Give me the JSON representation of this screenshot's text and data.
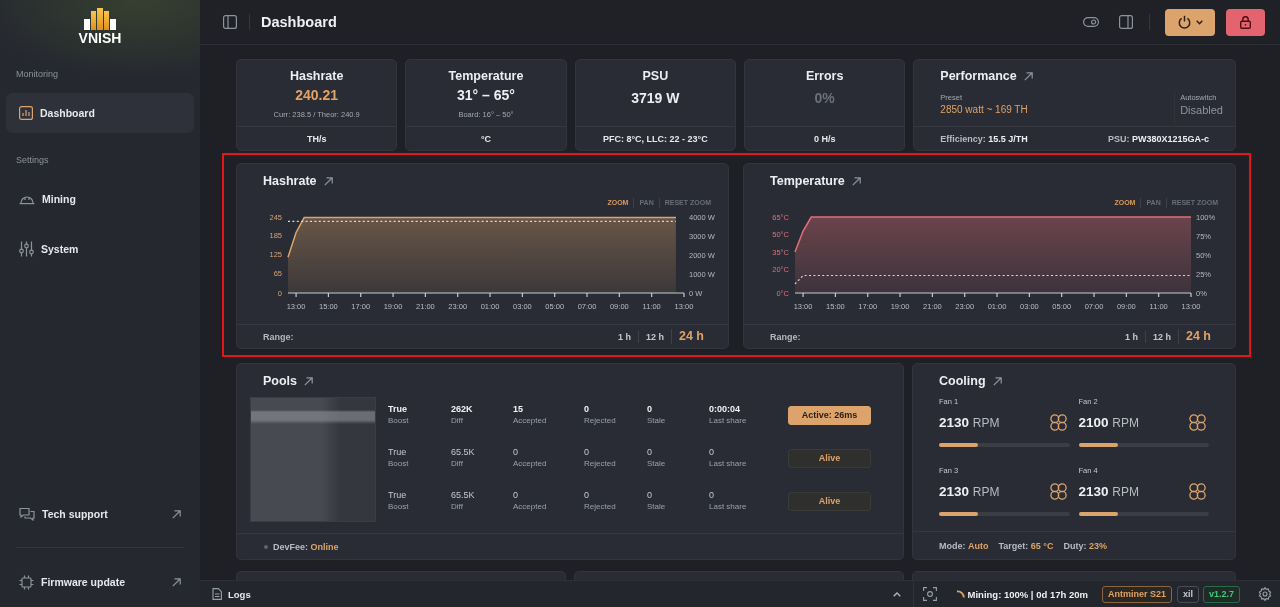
{
  "sidebar": {
    "logo": "VNISH",
    "sections": [
      {
        "heading": "Monitoring",
        "items": [
          {
            "label": "Dashboard",
            "selected": true
          }
        ]
      },
      {
        "heading": "Settings",
        "items": [
          {
            "label": "Mining",
            "selected": false
          },
          {
            "label": "System",
            "selected": false
          }
        ]
      }
    ],
    "links": [
      {
        "label": "Tech support",
        "external": true
      },
      {
        "label": "Firmware update",
        "external": true
      }
    ]
  },
  "header": {
    "title": "Dashboard"
  },
  "stats": [
    {
      "kind": "stat",
      "title": "Hashrate",
      "value": "240.21",
      "color": "#e0a265",
      "sub": "Curr: 238.5 / Theor: 240.9",
      "footer": "TH/s"
    },
    {
      "kind": "stat",
      "title": "Temperature",
      "value": "31° – 65°",
      "color": "#eceef1",
      "sub": "Board: 16° – 50°",
      "footer": "°C"
    },
    {
      "kind": "stat",
      "title": "PSU",
      "value": "3719 W",
      "color": "#eceef1",
      "footer": "PFC: 8°C, LLC: 22 - 23°C"
    },
    {
      "kind": "stat",
      "title": "Errors",
      "value": "0%",
      "color": "#6b7079",
      "footer": "0 H/s"
    },
    {
      "kind": "performance",
      "title": "Performance",
      "preset_label": "Preset",
      "preset": "2850 watt ~ 169 TH",
      "autoswitch_label": "Autoswitch",
      "autoswitch": "Disabled",
      "footer": [
        {
          "label": "Efficiency:",
          "value": "15.5 J/TH"
        },
        {
          "label": "PSU:",
          "value": "PW380X1215GA-c"
        }
      ]
    }
  ],
  "charts": {
    "highlighted": true,
    "items": [
      {
        "title": "Hashrate",
        "tools": [
          {
            "label": "ZOOM",
            "selected": true
          },
          {
            "label": "PAN",
            "selected": false
          },
          {
            "label": "RESET ZOOM",
            "selected": false
          }
        ],
        "chart_data": {
          "type": "area",
          "categories": [
            null,
            "13:00",
            null,
            null,
            null,
            "15:00",
            null,
            null,
            null,
            "17:00",
            null,
            null,
            null,
            "19:00",
            null,
            null,
            null,
            "21:00",
            null,
            null,
            null,
            "23:00",
            null,
            null,
            null,
            "01:00",
            null,
            null,
            null,
            "03:00",
            null,
            null,
            null,
            "05:00",
            null,
            null,
            null,
            "07:00",
            null,
            null,
            null,
            "09:00",
            null,
            null,
            null,
            "11:00",
            null,
            null,
            null,
            "13:00"
          ],
          "series": [
            {
              "color": "#dca46c",
              "values": [
                115,
                195,
                243,
                243,
                243,
                243,
                243,
                243,
                243,
                243,
                243,
                243,
                243,
                243,
                243,
                243,
                243,
                243,
                243,
                243,
                243,
                243,
                243,
                243,
                243,
                243,
                243,
                243,
                243,
                243,
                243,
                243,
                243,
                243,
                243,
                243,
                243,
                243,
                243,
                243,
                243,
                243,
                243,
                243,
                243,
                243,
                243,
                243,
                243,
                null
              ]
            },
            {
              "type": "line",
              "line_style": "dashed",
              "axis": "y2",
              "color": "#d9dadc",
              "values": [
                3770,
                3770,
                3770,
                3770,
                3770,
                3770,
                3770,
                3770,
                3770,
                3770,
                3770,
                3770,
                3770,
                3770,
                3770,
                3770,
                3770,
                3770,
                3770,
                3770,
                3770,
                3770,
                3770,
                3770,
                3770,
                3770,
                3770,
                3770,
                3770,
                3770,
                3770,
                3770,
                3770,
                3770,
                3770,
                3770,
                3770,
                3770,
                3770,
                3770,
                3770,
                3770,
                3770,
                3770,
                3770,
                3770,
                3770,
                3770,
                3770,
                null
              ]
            }
          ],
          "ylim": [
            0,
            245
          ],
          "yticks": [
            0,
            65,
            125,
            185,
            245
          ],
          "y2lim": [
            0,
            4000
          ],
          "y2ticks": [
            {
              "value": 0,
              "label": "0 W"
            },
            {
              "value": 1000,
              "label": "1000 W"
            },
            {
              "value": 2000,
              "label": "2000 W"
            },
            {
              "value": 3000,
              "label": "3000 W"
            },
            {
              "value": 4000,
              "label": "4000 W"
            }
          ]
        },
        "range_label": "Range:",
        "ranges": [
          {
            "label": "1 h",
            "selected": false
          },
          {
            "label": "12 h",
            "selected": false
          },
          {
            "label": "24 h",
            "selected": true
          }
        ]
      },
      {
        "title": "Temperature",
        "tools": [
          {
            "label": "ZOOM",
            "selected": true
          },
          {
            "label": "PAN",
            "selected": false
          },
          {
            "label": "RESET ZOOM",
            "selected": false
          }
        ],
        "chart_data": {
          "type": "area",
          "categories": [
            null,
            "13:00",
            null,
            null,
            null,
            "15:00",
            null,
            null,
            null,
            "17:00",
            null,
            null,
            null,
            "19:00",
            null,
            null,
            null,
            "21:00",
            null,
            null,
            null,
            "23:00",
            null,
            null,
            null,
            "01:00",
            null,
            null,
            null,
            "03:00",
            null,
            null,
            null,
            "05:00",
            null,
            null,
            null,
            "07:00",
            null,
            null,
            null,
            "09:00",
            null,
            null,
            null,
            "11:00",
            null,
            null,
            null,
            "13:00"
          ],
          "series": [
            {
              "color": "#e46f78",
              "values": [
                35,
                53,
                65,
                65,
                65,
                65,
                65,
                65,
                65,
                65,
                65,
                65,
                65,
                65,
                65,
                65,
                65,
                65,
                65,
                65,
                65,
                65,
                65,
                65,
                65,
                65,
                65,
                65,
                65,
                65,
                65,
                65,
                65,
                65,
                65,
                65,
                65,
                65,
                65,
                65,
                65,
                65,
                65,
                65,
                65,
                65,
                65,
                65,
                65,
                65
              ]
            },
            {
              "type": "line",
              "line_style": "dashed",
              "axis": "y2",
              "color": "#d9dadc",
              "values": [
                12,
                23,
                23,
                23,
                23,
                23,
                23,
                23,
                23,
                23,
                23,
                23,
                23,
                23,
                23,
                23,
                23,
                23,
                23,
                23,
                23,
                23,
                23,
                23,
                23,
                23,
                23,
                23,
                23,
                23,
                23,
                23,
                23,
                23,
                23,
                23,
                23,
                23,
                23,
                23,
                23,
                23,
                23,
                23,
                23,
                23,
                23,
                23,
                23,
                23
              ]
            }
          ],
          "ylim": [
            0,
            65
          ],
          "yticks": [
            {
              "value": 0,
              "label": "0°C"
            },
            {
              "value": 20,
              "label": "20°C"
            },
            {
              "value": 35,
              "label": "35°C"
            },
            {
              "value": 50,
              "label": "50°C"
            },
            {
              "value": 65,
              "label": "65°C"
            }
          ],
          "y2lim": [
            0,
            100
          ],
          "y2ticks": [
            {
              "value": 0,
              "label": "0%"
            },
            {
              "value": 25,
              "label": "25%"
            },
            {
              "value": 50,
              "label": "50%"
            },
            {
              "value": 75,
              "label": "75%"
            },
            {
              "value": 100,
              "label": "100%"
            }
          ]
        },
        "range_label": "Range:",
        "ranges": [
          {
            "label": "1 h",
            "selected": false
          },
          {
            "label": "12 h",
            "selected": false
          },
          {
            "label": "24 h",
            "selected": true
          }
        ]
      }
    ]
  },
  "pools": {
    "title": "Pools",
    "rows": [
      {
        "active": true,
        "cells": [
          {
            "value": "True",
            "label": "Boost"
          },
          {
            "value": "262K",
            "label": "Diff"
          },
          {
            "value": "15",
            "label": "Accepted"
          },
          {
            "value": "0",
            "label": "Rejected"
          },
          {
            "value": "0",
            "label": "Stale"
          },
          {
            "value": "0:00:04",
            "label": "Last share"
          }
        ],
        "status": "Active: 26ms"
      },
      {
        "active": false,
        "cells": [
          {
            "value": "True",
            "label": "Boost"
          },
          {
            "value": "65.5K",
            "label": "Diff"
          },
          {
            "value": "0",
            "label": "Accepted"
          },
          {
            "value": "0",
            "label": "Rejected"
          },
          {
            "value": "0",
            "label": "Stale"
          },
          {
            "value": "0",
            "label": "Last share"
          }
        ],
        "status": "Alive"
      },
      {
        "active": false,
        "cells": [
          {
            "value": "True",
            "label": "Boost"
          },
          {
            "value": "65.5K",
            "label": "Diff"
          },
          {
            "value": "0",
            "label": "Accepted"
          },
          {
            "value": "0",
            "label": "Rejected"
          },
          {
            "value": "0",
            "label": "Stale"
          },
          {
            "value": "0",
            "label": "Last share"
          }
        ],
        "status": "Alive"
      }
    ],
    "devfee": {
      "label": "DevFee:",
      "value": "Online"
    }
  },
  "cooling": {
    "title": "Cooling",
    "fans": [
      {
        "name": "Fan 1",
        "rpm": "2130",
        "unit": "RPM",
        "level": 0.3
      },
      {
        "name": "Fan 2",
        "rpm": "2100",
        "unit": "RPM",
        "level": 0.3
      },
      {
        "name": "Fan 3",
        "rpm": "2130",
        "unit": "RPM",
        "level": 0.3
      },
      {
        "name": "Fan 4",
        "rpm": "2130",
        "unit": "RPM",
        "level": 0.3
      }
    ],
    "footer": [
      {
        "label": "Mode:",
        "value": "Auto"
      },
      {
        "label": "Target:",
        "value": "65 °C"
      },
      {
        "label": "Duty:",
        "value": "23%"
      }
    ]
  },
  "status_bar": {
    "logs": "Logs",
    "mining": "Mining: 100% | 0d 17h 20m",
    "model": "Antminer S21",
    "tag": "xil",
    "version": "v1.2.7"
  }
}
